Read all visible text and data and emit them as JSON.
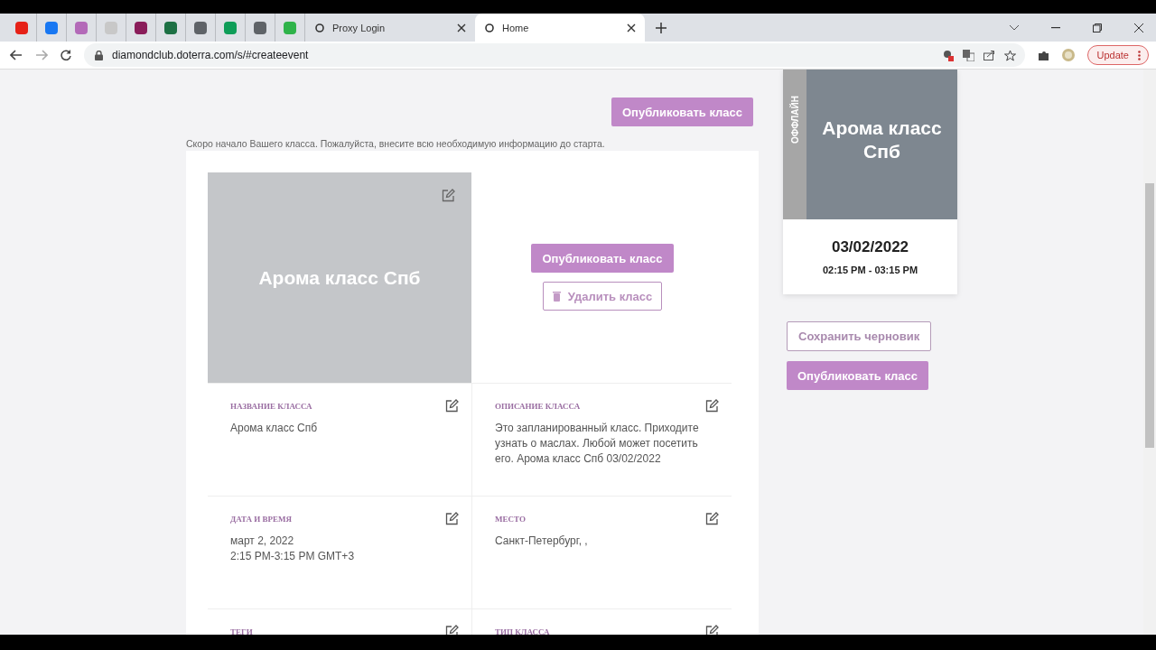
{
  "browser": {
    "tabs": [
      {
        "kind": "pinned",
        "color": "#e62117",
        "selected": false
      },
      {
        "kind": "pinned",
        "color": "#1877f2",
        "selected": false
      },
      {
        "kind": "pinned",
        "color": "#b36ab8",
        "selected": false
      },
      {
        "kind": "pinned",
        "color": "#c8c8c8",
        "selected": false
      },
      {
        "kind": "pinned",
        "color": "#8a1d5a",
        "selected": false
      },
      {
        "kind": "pinned",
        "color": "#1d7044",
        "selected": false
      },
      {
        "kind": "pinned",
        "color": "#5f6368",
        "selected": false
      },
      {
        "kind": "pinned",
        "color": "#0f9d58",
        "selected": false
      },
      {
        "kind": "pinned",
        "color": "#5f6368",
        "selected": false
      },
      {
        "kind": "pinned",
        "color": "#2fb34a",
        "selected": false
      },
      {
        "kind": "page",
        "label": "Proxy Login",
        "selected": false
      },
      {
        "kind": "page",
        "label": "Home",
        "selected": true
      }
    ],
    "url": "diamondclub.doterra.com/s/#createevent",
    "update_label": "Update"
  },
  "header": {
    "publish_button": "Опубликовать класс",
    "notice": "Скоро начало Вашего класса. Пожалуйста, внесите всю необходимую информацию до старта."
  },
  "cover": {
    "title": "Арома класс Спб"
  },
  "actions": {
    "publish_button": "Опубликовать класс",
    "delete_button": "Удалить класс"
  },
  "fields": [
    {
      "label": "НАЗВАНИЕ КЛАССА",
      "lines": [
        "Арома класс Спб"
      ]
    },
    {
      "label": "ОПИСАНИЕ КЛАССА",
      "lines": [
        "Это запланированный класс. Приходите узнать о маслах. Любой может посетить его. Арома класс Спб 03/02/2022"
      ]
    },
    {
      "label": "ДАТА И ВРЕМЯ",
      "lines": [
        "март 2, 2022",
        "2:15 PM-3:15 PM GMT+3"
      ]
    },
    {
      "label": "МЕСТО",
      "lines": [
        "Санкт-Петербург, ,"
      ]
    },
    {
      "label": "ТЕГИ"
    },
    {
      "label": "ТИП КЛАССА"
    }
  ],
  "preview": {
    "badge": "ОФФЛАЙН",
    "title": "Арома класс Спб",
    "date": "03/02/2022",
    "time": "02:15 PM - 03:15 PM"
  },
  "sidebar_buttons": {
    "save_draft": "Сохранить черновик",
    "publish": "Опубликовать класс"
  }
}
